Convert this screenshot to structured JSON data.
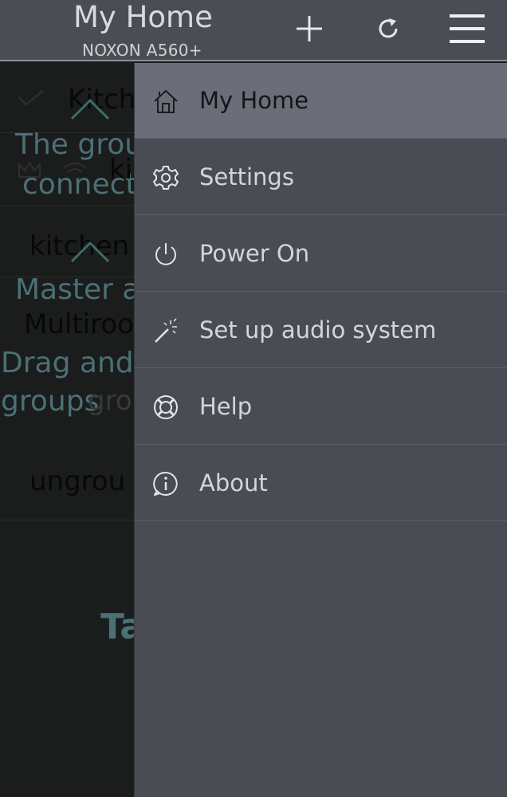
{
  "header": {
    "title": "My Home",
    "subtitle": "NOXON A560+",
    "add_icon": "plus-icon",
    "refresh_icon": "refresh-icon",
    "menu_icon": "hamburger-menu-icon"
  },
  "background": {
    "row1_label": "Kitch",
    "group_text_1": "The grou",
    "group_text_2": "connect",
    "row2_label": "ki",
    "row3_label": "kitchen",
    "master_text": "Master a",
    "multiroom_text": "Multiroo",
    "drag_text_1": "Drag and",
    "drag_text_2": "groups",
    "group_row_label": "grou",
    "ungroup_label": "ungrou",
    "tap_text": "Ta"
  },
  "menu": {
    "items": [
      {
        "label": "My Home",
        "icon": "home-icon",
        "active": true
      },
      {
        "label": "Settings",
        "icon": "gear-icon",
        "active": false
      },
      {
        "label": "Power On",
        "icon": "power-icon",
        "active": false
      },
      {
        "label": "Set up audio system",
        "icon": "magic-wand-icon",
        "active": false
      },
      {
        "label": "Help",
        "icon": "lifebuoy-icon",
        "active": false
      },
      {
        "label": "About",
        "icon": "info-icon",
        "active": false
      }
    ]
  },
  "colors": {
    "topbar": "#4b4d55",
    "drawer": "#4a4c54",
    "active_item": "#6b6e78",
    "teal_text": "#4b7075"
  }
}
